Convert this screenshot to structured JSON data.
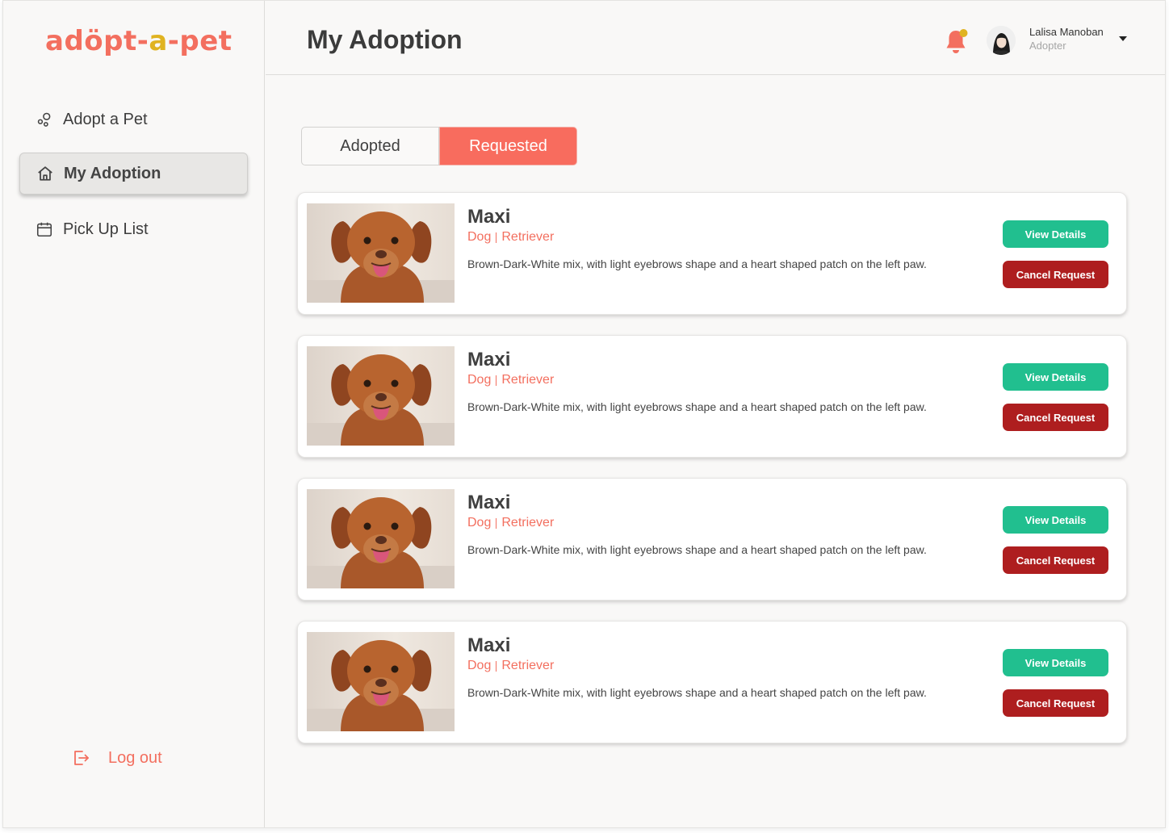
{
  "app": {
    "logo_part1": "ad",
    "logo_paw": "ö",
    "logo_part2": "pt-",
    "logo_part3": "a",
    "logo_part4": "-pet",
    "brand_color": "#f36f5f",
    "accent_color": "#e0b321"
  },
  "sidebar": {
    "items": [
      {
        "label": "Adopt a Pet",
        "icon": "bubbles-icon",
        "active": false
      },
      {
        "label": "My Adoption",
        "icon": "home-icon",
        "active": true
      },
      {
        "label": "Pick Up List",
        "icon": "calendar-icon",
        "active": false
      }
    ],
    "logout_label": "Log out"
  },
  "header": {
    "title": "My Adoption",
    "notification_icon": "bell-icon",
    "user": {
      "name": "Lalisa Manoban",
      "role": "Adopter"
    }
  },
  "tabs": [
    {
      "label": "Adopted",
      "active": false
    },
    {
      "label": "Requested",
      "active": true
    }
  ],
  "pets": [
    {
      "name": "Maxi",
      "type": "Dog",
      "breed": "Retriever",
      "description": "Brown-Dark-White mix, with light eyebrows shape and a heart shaped patch on the left paw.",
      "view_label": "View Details",
      "cancel_label": "Cancel Request"
    },
    {
      "name": "Maxi",
      "type": "Dog",
      "breed": "Retriever",
      "description": "Brown-Dark-White mix, with light eyebrows shape and a heart shaped patch on the left paw.",
      "view_label": "View Details",
      "cancel_label": "Cancel Request"
    },
    {
      "name": "Maxi",
      "type": "Dog",
      "breed": "Retriever",
      "description": "Brown-Dark-White mix, with light eyebrows shape and a heart shaped patch on the left paw.",
      "view_label": "View Details",
      "cancel_label": "Cancel Request"
    },
    {
      "name": "Maxi",
      "type": "Dog",
      "breed": "Retriever",
      "description": "Brown-Dark-White mix, with light eyebrows shape and a heart shaped patch on the left paw.",
      "view_label": "View Details",
      "cancel_label": "Cancel Request"
    }
  ],
  "colors": {
    "view_button": "#21bf8f",
    "cancel_button": "#ae1e1f",
    "active_tab": "#f86c5e"
  }
}
